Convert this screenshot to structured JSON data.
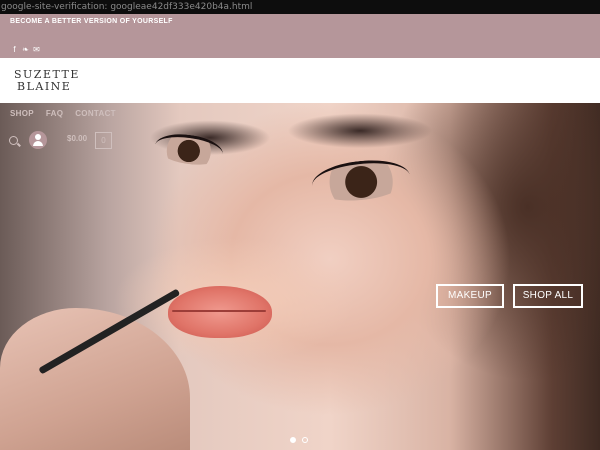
{
  "verification_text": "google-site-verification: googleae42df333e420b4a.html",
  "topbar": {
    "tagline": "BECOME A BETTER VERSION OF YOURSELF",
    "socials": [
      {
        "icon": "facebook-icon",
        "glyph": "f"
      },
      {
        "icon": "twitter-icon",
        "glyph": "❧"
      },
      {
        "icon": "email-icon",
        "glyph": "✉"
      }
    ]
  },
  "logo": {
    "line1": "SUZETTE",
    "line2": "BLAINE"
  },
  "nav": {
    "items": [
      "SHOP",
      "FAQ",
      "CONTACT"
    ]
  },
  "cart": {
    "total": "$0.00",
    "count": "0"
  },
  "hero": {
    "buttons": [
      "MAKEUP",
      "SHOP ALL"
    ],
    "slides": 2,
    "active_slide": 1
  },
  "colors": {
    "accent": "#b5969a"
  }
}
